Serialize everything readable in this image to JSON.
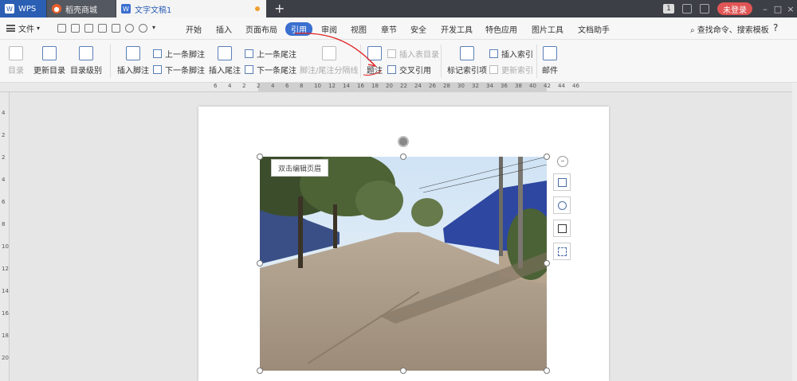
{
  "titlebar": {
    "tabs": [
      {
        "label": "WPS"
      },
      {
        "label": "稻壳商城"
      },
      {
        "label": "文字文稿1"
      }
    ],
    "new_tab": "+",
    "badge": "1",
    "login_label": "未登录",
    "window_controls": [
      "–",
      "□",
      "×"
    ]
  },
  "menubar": {
    "file_label": "文件",
    "items": [
      "开始",
      "插入",
      "页面布局",
      "引用",
      "审阅",
      "视图",
      "章节",
      "安全",
      "开发工具",
      "特色应用",
      "图片工具",
      "文档助手"
    ],
    "active": "引用",
    "search_label": "查找命令、搜索模板",
    "help": "?"
  },
  "ribbon": {
    "toc": "目录",
    "update_toc": "更新目录",
    "toc_level": "目录级别",
    "insert_footnote": "插入脚注",
    "prev_footnote": "上一条脚注",
    "next_footnote": "下一条脚注",
    "insert_endnote": "插入尾注",
    "prev_endnote": "上一条尾注",
    "next_endnote": "下一条尾注",
    "footnote_separator": "脚注/尾注分隔线",
    "caption": "题注",
    "insert_table_of_figures": "插入表目录",
    "cross_reference": "交叉引用",
    "mark_index": "标记索引项",
    "insert_index": "插入索引",
    "update_index": "更新索引",
    "mail": "邮件"
  },
  "ruler": {
    "top_numbers": [
      "6",
      "4",
      "2",
      "2",
      "4",
      "6",
      "8",
      "10",
      "12",
      "14",
      "16",
      "18",
      "20",
      "22",
      "24",
      "26",
      "28",
      "30",
      "32",
      "34",
      "36",
      "38",
      "40",
      "42",
      "44",
      "46"
    ],
    "left_numbers": [
      "4",
      "2",
      "2",
      "4",
      "6",
      "8",
      "10",
      "12",
      "14",
      "16",
      "18",
      "20"
    ]
  },
  "document": {
    "header_tip": "双击编辑页眉"
  },
  "colors": {
    "titlebar": "#3c3f46",
    "accent": "#3b6fd0",
    "login": "#e05555"
  }
}
